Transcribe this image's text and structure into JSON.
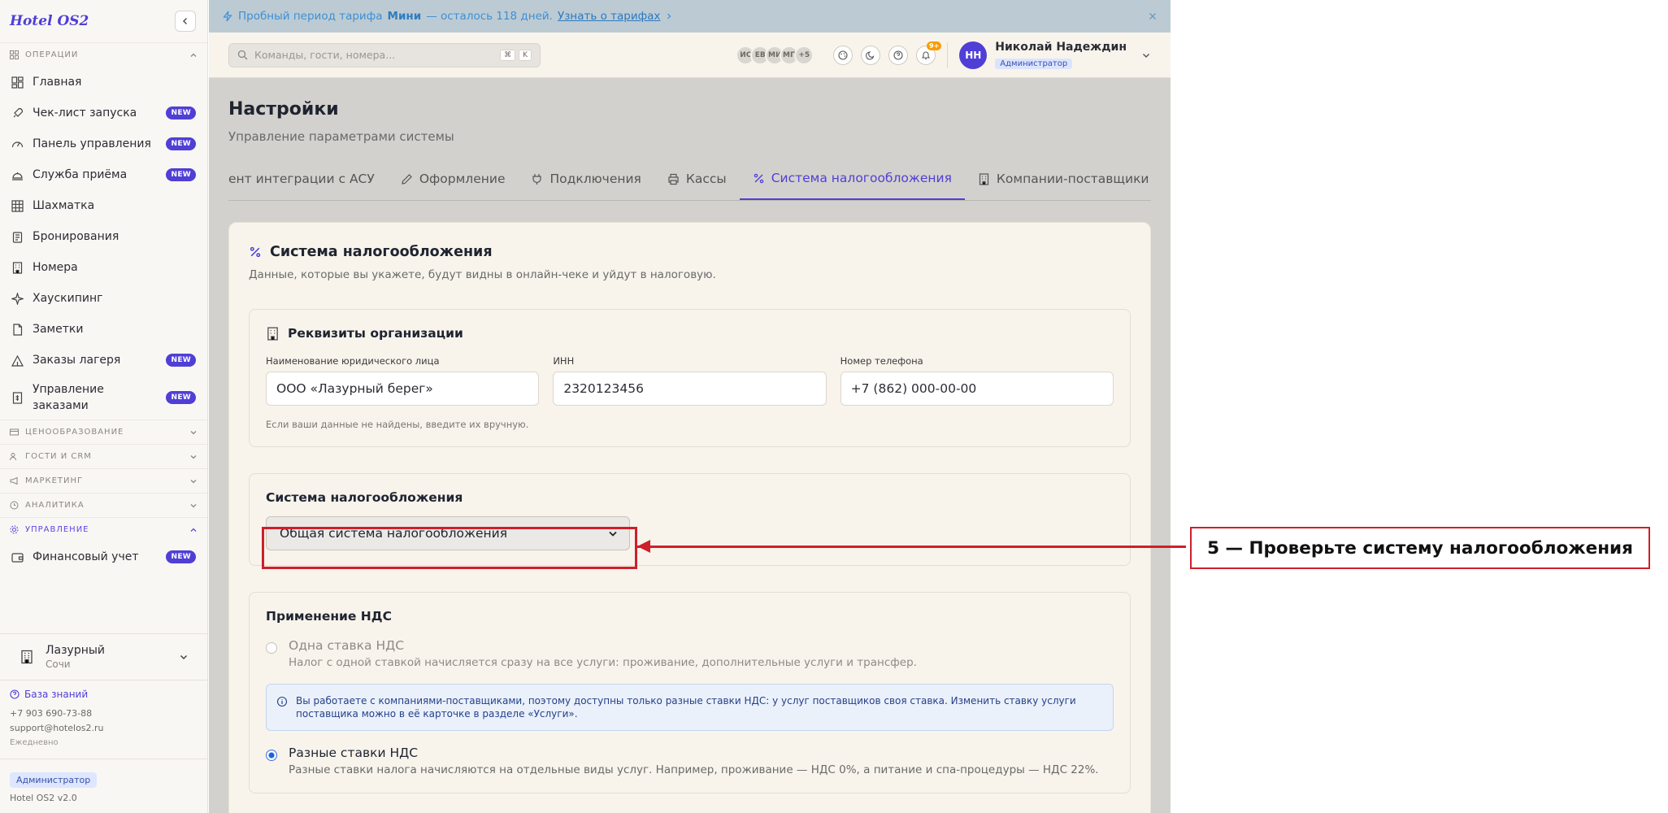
{
  "app": {
    "logo": "Hotel OS2",
    "version": "Hotel OS2 v2.0"
  },
  "sidebar": {
    "sections": {
      "operations": "ОПЕРАЦИИ",
      "pricing": "ЦЕНООБРАЗОВАНИЕ",
      "guests": "ГОСТИ И CRM",
      "marketing": "МАРКЕТИНГ",
      "analytics": "АНАЛИТИКА",
      "management": "УПРАВЛЕНИЕ"
    },
    "items": [
      {
        "label": "Главная",
        "badge": ""
      },
      {
        "label": "Чек-лист запуска",
        "badge": "NEW"
      },
      {
        "label": "Панель управления",
        "badge": "NEW"
      },
      {
        "label": "Служба приёма",
        "badge": "NEW"
      },
      {
        "label": "Шахматка",
        "badge": ""
      },
      {
        "label": "Бронирования",
        "badge": ""
      },
      {
        "label": "Номера",
        "badge": ""
      },
      {
        "label": "Хаускипинг",
        "badge": ""
      },
      {
        "label": "Заметки",
        "badge": ""
      },
      {
        "label": "Заказы лагеря",
        "badge": "NEW"
      },
      {
        "label": "Управление заказами",
        "badge": "NEW"
      }
    ],
    "management_items": [
      {
        "label": "Финансовый учет",
        "badge": "NEW"
      }
    ],
    "hotel": {
      "name": "Лазурный",
      "city": "Сочи"
    },
    "support": {
      "kb": "База знаний",
      "phone": "+7 903 690-73-88",
      "email": "support@hotelos2.ru",
      "schedule": "Ежедневно"
    },
    "role": "Администратор"
  },
  "banner": {
    "prefix": "Пробный период тарифа",
    "plan": "Мини",
    "suffix": "— осталось 118 дней.",
    "link": "Узнать о тарифах"
  },
  "topbar": {
    "search_placeholder": "Команды, гости, номера...",
    "kbd1": "⌘",
    "kbd2": "K",
    "avatars": [
      "ИС",
      "ЕВ",
      "МИ",
      "МП",
      "+5"
    ],
    "notif_count": "9+",
    "user": {
      "initials": "НН",
      "name": "Николай Надеждин",
      "role": "Администратор"
    }
  },
  "page": {
    "title": "Настройки",
    "subtitle": "Управление параметрами системы",
    "tabs": [
      {
        "label": "ент интеграции с АСУ",
        "icon": ""
      },
      {
        "label": "Оформление",
        "icon": "pencil-icon"
      },
      {
        "label": "Подключения",
        "icon": "plug-icon"
      },
      {
        "label": "Кассы",
        "icon": "printer-icon"
      },
      {
        "label": "Система налогообложения",
        "icon": "percent-icon"
      },
      {
        "label": "Компании-поставщики",
        "icon": "building-icon"
      }
    ]
  },
  "tax_card": {
    "title": "Система налогообложения",
    "subtitle": "Данные, которые вы укажете, будут видны в онлайн-чеке и уйдут в налоговую.",
    "org": {
      "title": "Реквизиты организации",
      "legal_label": "Наименование юридического лица",
      "legal_value": "ООО «Лазурный берег»",
      "inn_label": "ИНН",
      "inn_value": "2320123456",
      "phone_label": "Номер телефона",
      "phone_value": "+7 (862) 000-00-00",
      "hint": "Если ваши данные не найдены, введите их вручную."
    },
    "tax_system": {
      "title": "Система налогообложения",
      "selected": "Общая система налогообложения"
    },
    "vat": {
      "title": "Применение НДС",
      "single_title": "Одна ставка НДС",
      "single_desc": "Налог с одной ставкой начисляется сразу на все услуги: проживание, дополнительные услуги и трансфер.",
      "info": "Вы работаете с компаниями-поставщиками, поэтому доступны только разные ставки НДС: у услуг поставщиков своя ставка. Изменить ставку услуги поставщика можно в её карточке в разделе «Услуги».",
      "multi_title": "Разные ставки НДС",
      "multi_desc": "Разные ставки налога начисляются на отдельные виды услуг. Например, проживание — НДС 0%, а питание и спа-процедуры — НДС 22%."
    }
  },
  "annotation": {
    "text": "5 — Проверьте систему налогообложения",
    "color": "#cf1f2a"
  }
}
